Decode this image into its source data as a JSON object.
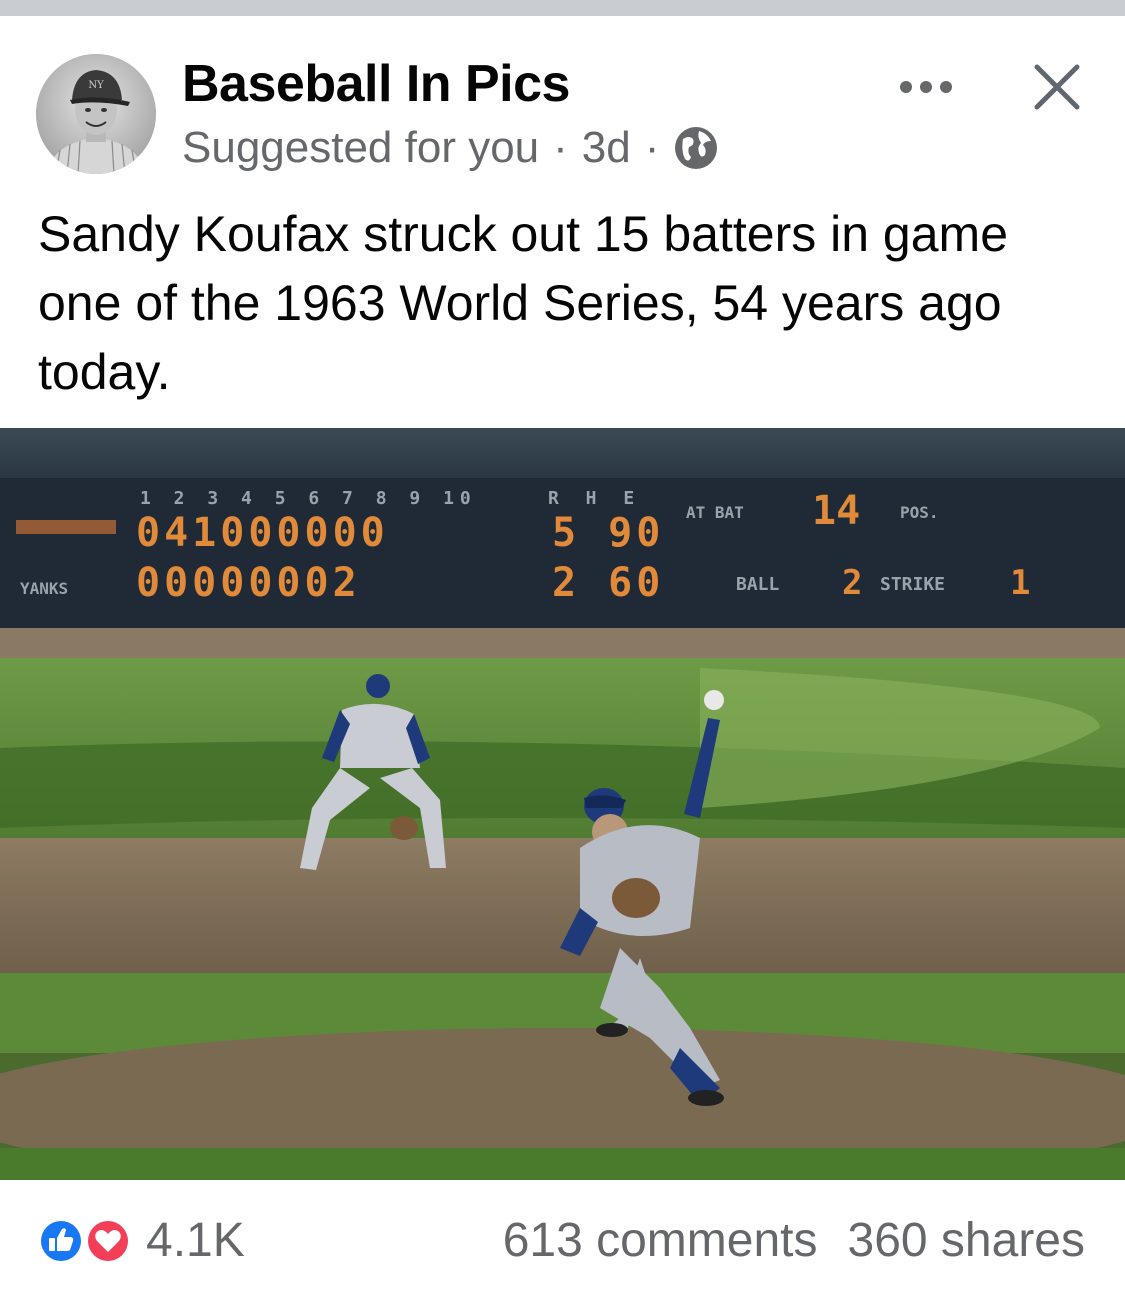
{
  "post": {
    "page_name": "Baseball In Pics",
    "meta": {
      "suggestion": "Suggested for you",
      "separator": "·",
      "time": "3d",
      "audience_icon": "globe-icon"
    },
    "text": "Sandy Koufax struck out 15 batters in game one of the 1963 World Series, 54 years ago today.",
    "photo": {
      "scoreboard": {
        "innings_header": "1 2 3 4 5 6 7 8 9 10",
        "rhe_header": "R H E",
        "row1_label": "",
        "row1_innings": "041000000",
        "row1_rhe": "5 90",
        "row2_label": "YANKS",
        "row2_innings": "00000002",
        "row2_rhe": "2 60",
        "at_bat_label": "AT BAT",
        "at_bat_value": "14",
        "pos_label": "POS.",
        "ball_label": "BALL",
        "ball_value": "2",
        "strike_label": "STRIKE",
        "strike_value": "1"
      }
    }
  },
  "header_actions": {
    "more_icon": "more-horizontal-icon",
    "close_icon": "close-icon"
  },
  "footer": {
    "reaction_icons": [
      "like-icon",
      "love-icon"
    ],
    "reaction_count": "4.1K",
    "comments": "613 comments",
    "shares": "360 shares"
  },
  "colors": {
    "like_blue": "#1877f2",
    "love_red": "#f33e58",
    "secondary_text": "#65676b",
    "divider": "#c9ccd1",
    "scoreboard_digits": "#e08a3a"
  }
}
